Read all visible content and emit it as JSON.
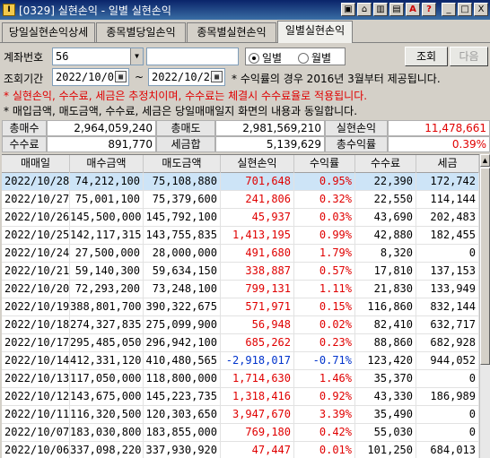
{
  "window": {
    "app_icon": "Ⅰ",
    "title": "[0329] 실현손익 - 일별 실현손익",
    "buttons": [
      "▣",
      "⌂",
      "▥",
      "▤",
      "A",
      "?",
      "_",
      "□",
      "X"
    ]
  },
  "tabs": [
    {
      "label": "당일실현손익상세",
      "active": false
    },
    {
      "label": "종목별당일손익",
      "active": false
    },
    {
      "label": "종목별실현손익",
      "active": false
    },
    {
      "label": "일별실현손익",
      "active": true
    }
  ],
  "filters": {
    "account_label": "계좌번호",
    "account_value": "56",
    "period_label": "조회기간",
    "date_from": "2022/10/01",
    "date_to": "2022/10/28",
    "tilde": "~",
    "radio_daily": "일별",
    "radio_monthly": "월별",
    "note_yield": "* 수익률의 경우 2016년 3월부터 제공됩니다.",
    "search_button": "조회",
    "next_button": "다음",
    "notice_red": "* 실현손익, 수수료, 세금은 추정치이며, 수수료는 체결시 수수료율로 적용됩니다.",
    "notice_black": "* 매입금액, 매도금액, 수수료, 세금은 당일매매일지 화면의 내용과 동일합니다."
  },
  "summary": {
    "total_buy_label": "총매수",
    "total_buy": "2,964,059,240",
    "total_sell_label": "총매도",
    "total_sell": "2,981,569,210",
    "realized_label": "실현손익",
    "realized": "11,478,661",
    "fee_label": "수수료",
    "fee": "891,770",
    "tax_label": "세금합",
    "tax": "5,139,629",
    "yield_label": "총수익률",
    "yield": "0.39%"
  },
  "grid": {
    "headers": [
      "매매일",
      "매수금액",
      "매도금액",
      "실현손익",
      "수익률",
      "수수료",
      "세금"
    ],
    "rows": [
      [
        "2022/10/28",
        "74,212,100",
        "75,108,880",
        "701,648",
        "0.95%",
        "22,390",
        "172,742"
      ],
      [
        "2022/10/27",
        "75,001,100",
        "75,379,600",
        "241,806",
        "0.32%",
        "22,550",
        "114,144"
      ],
      [
        "2022/10/26",
        "145,500,000",
        "145,792,100",
        "45,937",
        "0.03%",
        "43,690",
        "202,483"
      ],
      [
        "2022/10/25",
        "142,117,315",
        "143,755,835",
        "1,413,195",
        "0.99%",
        "42,880",
        "182,455"
      ],
      [
        "2022/10/24",
        "27,500,000",
        "28,000,000",
        "491,680",
        "1.79%",
        "8,320",
        "0"
      ],
      [
        "2022/10/21",
        "59,140,300",
        "59,634,150",
        "338,887",
        "0.57%",
        "17,810",
        "137,153"
      ],
      [
        "2022/10/20",
        "72,293,200",
        "73,248,100",
        "799,131",
        "1.11%",
        "21,830",
        "133,949"
      ],
      [
        "2022/10/19",
        "388,801,700",
        "390,322,675",
        "571,971",
        "0.15%",
        "116,860",
        "832,144"
      ],
      [
        "2022/10/18",
        "274,327,835",
        "275,099,900",
        "56,948",
        "0.02%",
        "82,410",
        "632,717"
      ],
      [
        "2022/10/17",
        "295,485,050",
        "296,942,100",
        "685,262",
        "0.23%",
        "88,860",
        "682,928"
      ],
      [
        "2022/10/14",
        "412,331,120",
        "410,480,565",
        "-2,918,017",
        "-0.71%",
        "123,420",
        "944,052"
      ],
      [
        "2022/10/13",
        "117,050,000",
        "118,800,000",
        "1,714,630",
        "1.46%",
        "35,370",
        "0"
      ],
      [
        "2022/10/12",
        "143,675,000",
        "145,223,735",
        "1,318,416",
        "0.92%",
        "43,330",
        "186,989"
      ],
      [
        "2022/10/11",
        "116,320,500",
        "120,303,650",
        "3,947,670",
        "3.39%",
        "35,490",
        "0"
      ],
      [
        "2022/10/07",
        "183,030,800",
        "183,855,000",
        "769,180",
        "0.42%",
        "55,030",
        "0"
      ],
      [
        "2022/10/06",
        "337,098,220",
        "337,930,920",
        "47,447",
        "0.01%",
        "101,250",
        "684,013"
      ],
      [
        "2022/10/05",
        "100,175,000",
        "101,692,000",
        "1,252,870",
        "1.25%",
        "30,280",
        "233,860"
      ]
    ]
  },
  "colors": {
    "positive": "#e00000",
    "negative": "#0033cc",
    "selected_row": "#cde4f7",
    "title_bar": "#0a246a"
  },
  "icons": {
    "dropdown": "chevron-down-icon",
    "calendar": "calendar-icon",
    "scroll_up": "scroll-up-icon"
  }
}
